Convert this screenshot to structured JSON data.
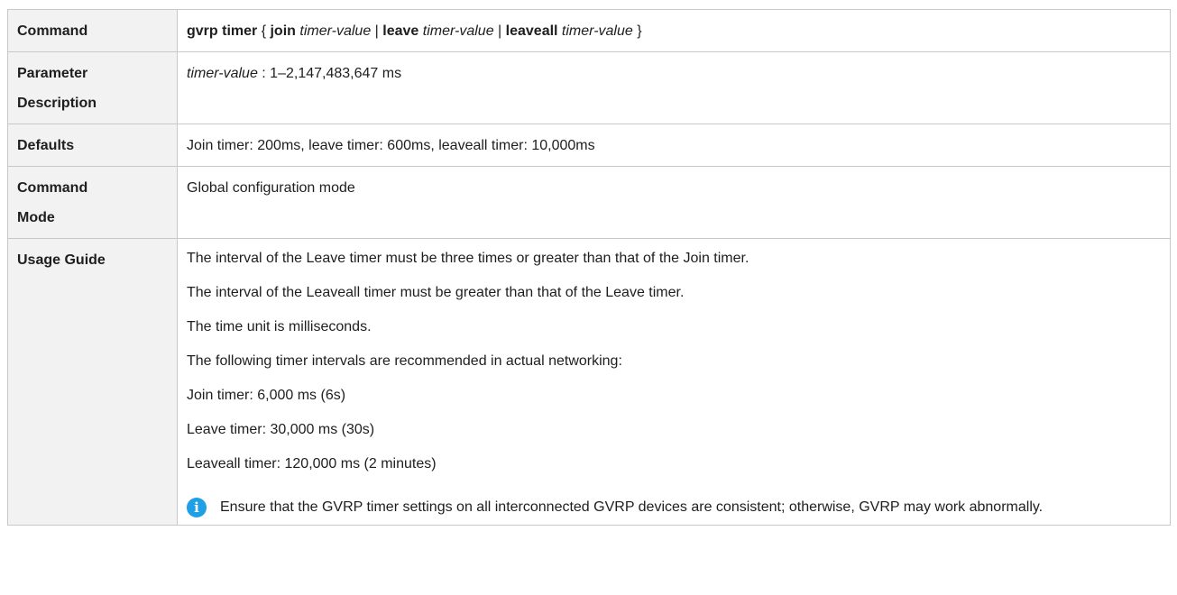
{
  "rows": {
    "command": {
      "label": "Command",
      "syntax": {
        "keyword": "gvrp timer",
        "open_brace": " { ",
        "join_kw": "join",
        "join_arg": " timer-value ",
        "sep1": "| ",
        "leave_kw": "leave",
        "leave_arg": " timer-value ",
        "sep2": "| ",
        "leaveall_kw": "leaveall",
        "leaveall_arg": " timer-value ",
        "close_brace": "}"
      }
    },
    "parameter": {
      "label_line1": "Parameter",
      "label_line2": "Description",
      "param_name": "timer-value",
      "param_desc": " : 1–2,147,483,647 ms"
    },
    "defaults": {
      "label": "Defaults",
      "value": "Join timer: 200ms, leave timer: 600ms, leaveall timer: 10,000ms"
    },
    "command_mode": {
      "label_line1": "Command",
      "label_line2": "Mode",
      "value": "Global configuration mode"
    },
    "usage_guide": {
      "label": "Usage Guide",
      "lines": [
        "The interval of the Leave timer must be three times or greater than that of the Join timer.",
        "The interval of the Leaveall timer must be greater than that of the Leave timer.",
        "The time unit is milliseconds.",
        "The following timer intervals are recommended in actual networking:",
        "Join timer: 6,000 ms (6s)",
        "Leave timer: 30,000 ms (30s)",
        "Leaveall timer: 120,000 ms (2 minutes)"
      ],
      "note": {
        "icon": "info-icon",
        "icon_glyph": "i",
        "text": "Ensure that the GVRP timer settings on all interconnected GVRP devices are consistent; otherwise, GVRP may work abnormally."
      }
    }
  }
}
